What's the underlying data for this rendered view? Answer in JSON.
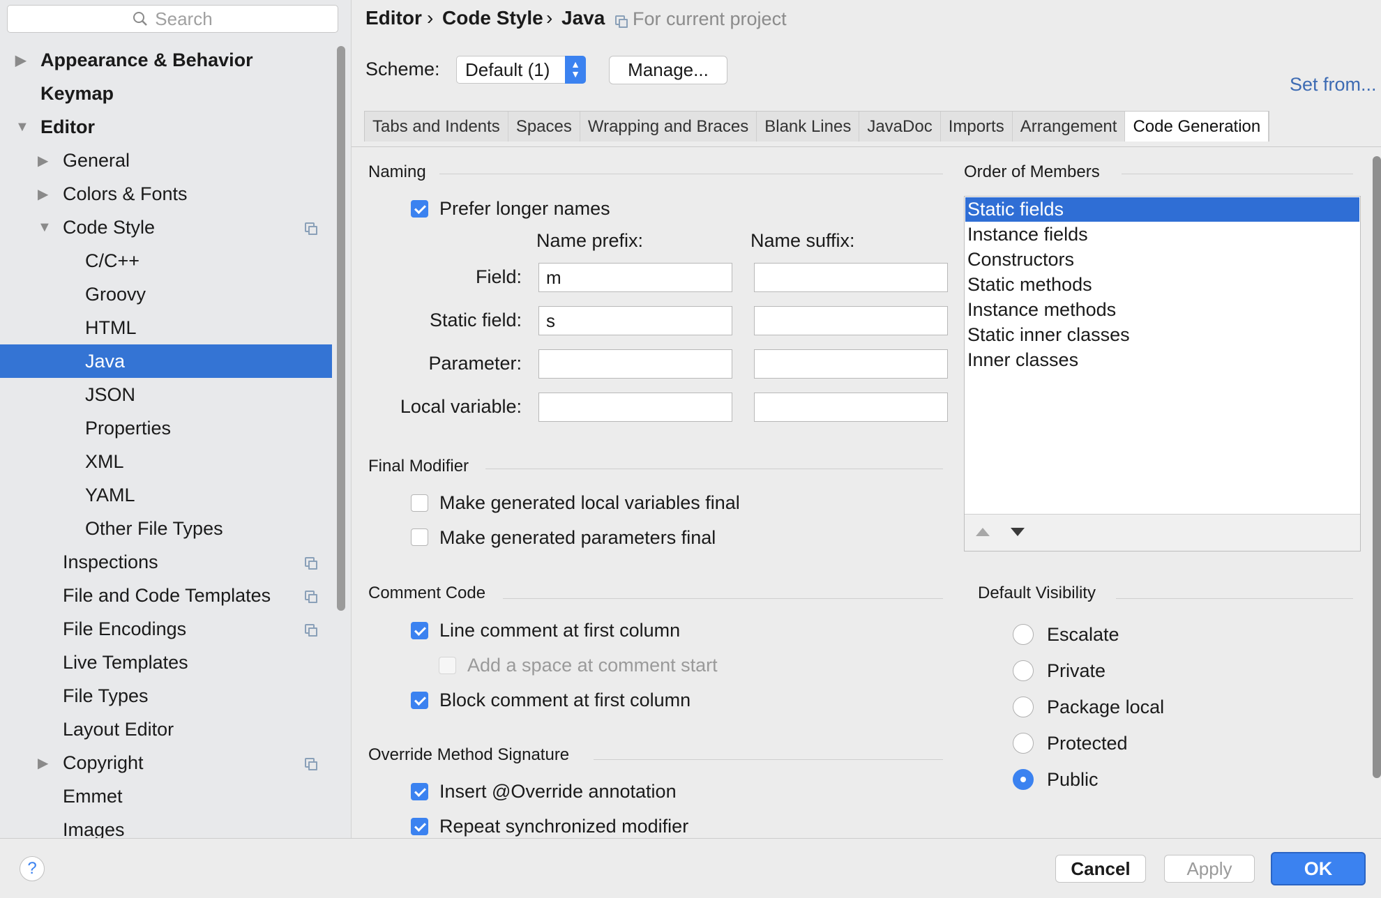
{
  "search": {
    "placeholder": "Search"
  },
  "sidebar": {
    "items": [
      {
        "label": "Appearance & Behavior",
        "arrow": "▶"
      },
      {
        "label": "Keymap"
      },
      {
        "label": "Editor",
        "arrow": "▼"
      },
      {
        "label": "General",
        "arrow": "▶"
      },
      {
        "label": "Colors & Fonts",
        "arrow": "▶"
      },
      {
        "label": "Code Style",
        "arrow": "▼"
      },
      {
        "label": "C/C++"
      },
      {
        "label": "Groovy"
      },
      {
        "label": "HTML"
      },
      {
        "label": "Java"
      },
      {
        "label": "JSON"
      },
      {
        "label": "Properties"
      },
      {
        "label": "XML"
      },
      {
        "label": "YAML"
      },
      {
        "label": "Other File Types"
      },
      {
        "label": "Inspections"
      },
      {
        "label": "File and Code Templates"
      },
      {
        "label": "File Encodings"
      },
      {
        "label": "Live Templates"
      },
      {
        "label": "File Types"
      },
      {
        "label": "Layout Editor"
      },
      {
        "label": "Copyright",
        "arrow": "▶"
      },
      {
        "label": "Emmet"
      },
      {
        "label": "Images"
      }
    ]
  },
  "header": {
    "breadcrumb": [
      "Editor",
      "Code Style",
      "Java"
    ],
    "separator": "›",
    "project_note": "For current project",
    "scheme_label": "Scheme:",
    "scheme_value": "Default (1)",
    "manage_label": "Manage...",
    "set_from_label": "Set from..."
  },
  "tabs": [
    "Tabs and Indents",
    "Spaces",
    "Wrapping and Braces",
    "Blank Lines",
    "JavaDoc",
    "Imports",
    "Arrangement",
    "Code Generation"
  ],
  "active_tab": "Code Generation",
  "naming": {
    "title": "Naming",
    "prefer_longer": "Prefer longer names",
    "prefix_header": "Name prefix:",
    "suffix_header": "Name suffix:",
    "rows": [
      {
        "label": "Field:",
        "prefix": "m",
        "suffix": ""
      },
      {
        "label": "Static field:",
        "prefix": "s",
        "suffix": ""
      },
      {
        "label": "Parameter:",
        "prefix": "",
        "suffix": ""
      },
      {
        "label": "Local variable:",
        "prefix": "",
        "suffix": ""
      }
    ]
  },
  "final_modifier": {
    "title": "Final Modifier",
    "local_vars": "Make generated local variables final",
    "params": "Make generated parameters final"
  },
  "comment_code": {
    "title": "Comment Code",
    "line_comment": "Line comment at first column",
    "add_space": "Add a space at comment start",
    "block_comment": "Block comment at first column"
  },
  "override": {
    "title": "Override Method Signature",
    "insert_annotation": "Insert @Override annotation",
    "repeat_sync": "Repeat synchronized modifier"
  },
  "order_of_members": {
    "title": "Order of Members",
    "items": [
      "Static fields",
      "Instance fields",
      "Constructors",
      "Static methods",
      "Instance methods",
      "Static inner classes",
      "Inner classes"
    ],
    "selected": "Static fields"
  },
  "default_visibility": {
    "title": "Default Visibility",
    "options": [
      "Escalate",
      "Private",
      "Package local",
      "Protected",
      "Public"
    ],
    "selected": "Public"
  },
  "footer": {
    "help": "?",
    "cancel": "Cancel",
    "apply": "Apply",
    "ok": "OK"
  },
  "colors": {
    "accent": "#3b82f0",
    "selection": "#3474d4",
    "link": "#3d6bb3"
  }
}
